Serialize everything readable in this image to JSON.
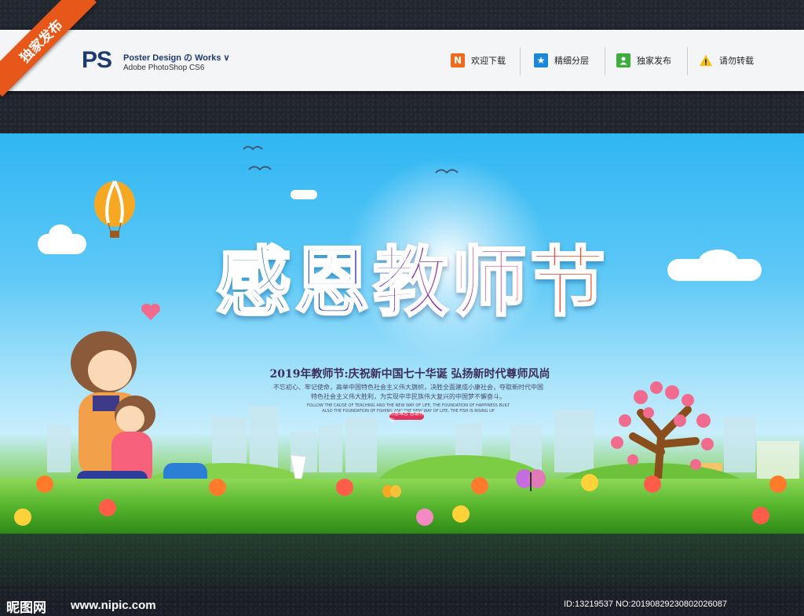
{
  "ribbon": {
    "label": "独家发布"
  },
  "header": {
    "logo": "PS",
    "brand_title": "Poster Design の Works ∨",
    "brand_subtitle": "Adobe PhotoShop CS6",
    "items": [
      {
        "icon_text": "N",
        "label": "欢迎下载",
        "icon_color": "#f06a1d",
        "icon_name": "n-icon"
      },
      {
        "icon_text": "★",
        "label": "精细分层",
        "icon_color": "#1e88d8",
        "icon_name": "star-icon"
      },
      {
        "icon_text": "👤",
        "label": "独家发布",
        "icon_color": "#3cae3a",
        "icon_name": "user-icon"
      },
      {
        "icon_text": "!",
        "label": "请勿转载",
        "icon_color": "#f3c01a",
        "icon_name": "warning-icon"
      }
    ]
  },
  "poster": {
    "title": "感恩教师节",
    "subtitle": "2019年教师节:庆祝新中国七十华诞  弘扬新时代尊师风尚",
    "paragraph": "不忘初心、牢记使命，高举中国特色社会主义伟大旗帜，决胜全面建成小康社会，夺取新时代中国特色社会主义伟大胜利，为实现中华民族伟大复兴的中国梦不懈奋斗。",
    "paragraph_en": "FOLLOW THE CAUSE OF TEACHING AND THE NEW WAY OF LIFE, THE FOUNDATION OF HAPPINESS BUILT ALSO THE FOUNDATION OF FISHING AND THE NEW WAY OF LIFE, THE FISH IS RISING UP",
    "tagline": "师恩难忘 感谢有你"
  },
  "footer": {
    "site_logo": "昵图网",
    "url": "www.nipic.com",
    "id_text": "ID:13219537 NO:20190829230802026087"
  },
  "colors": {
    "ribbon": "#e8571a",
    "header_bg": "#f4f5f7",
    "brand": "#1e3a6e"
  }
}
